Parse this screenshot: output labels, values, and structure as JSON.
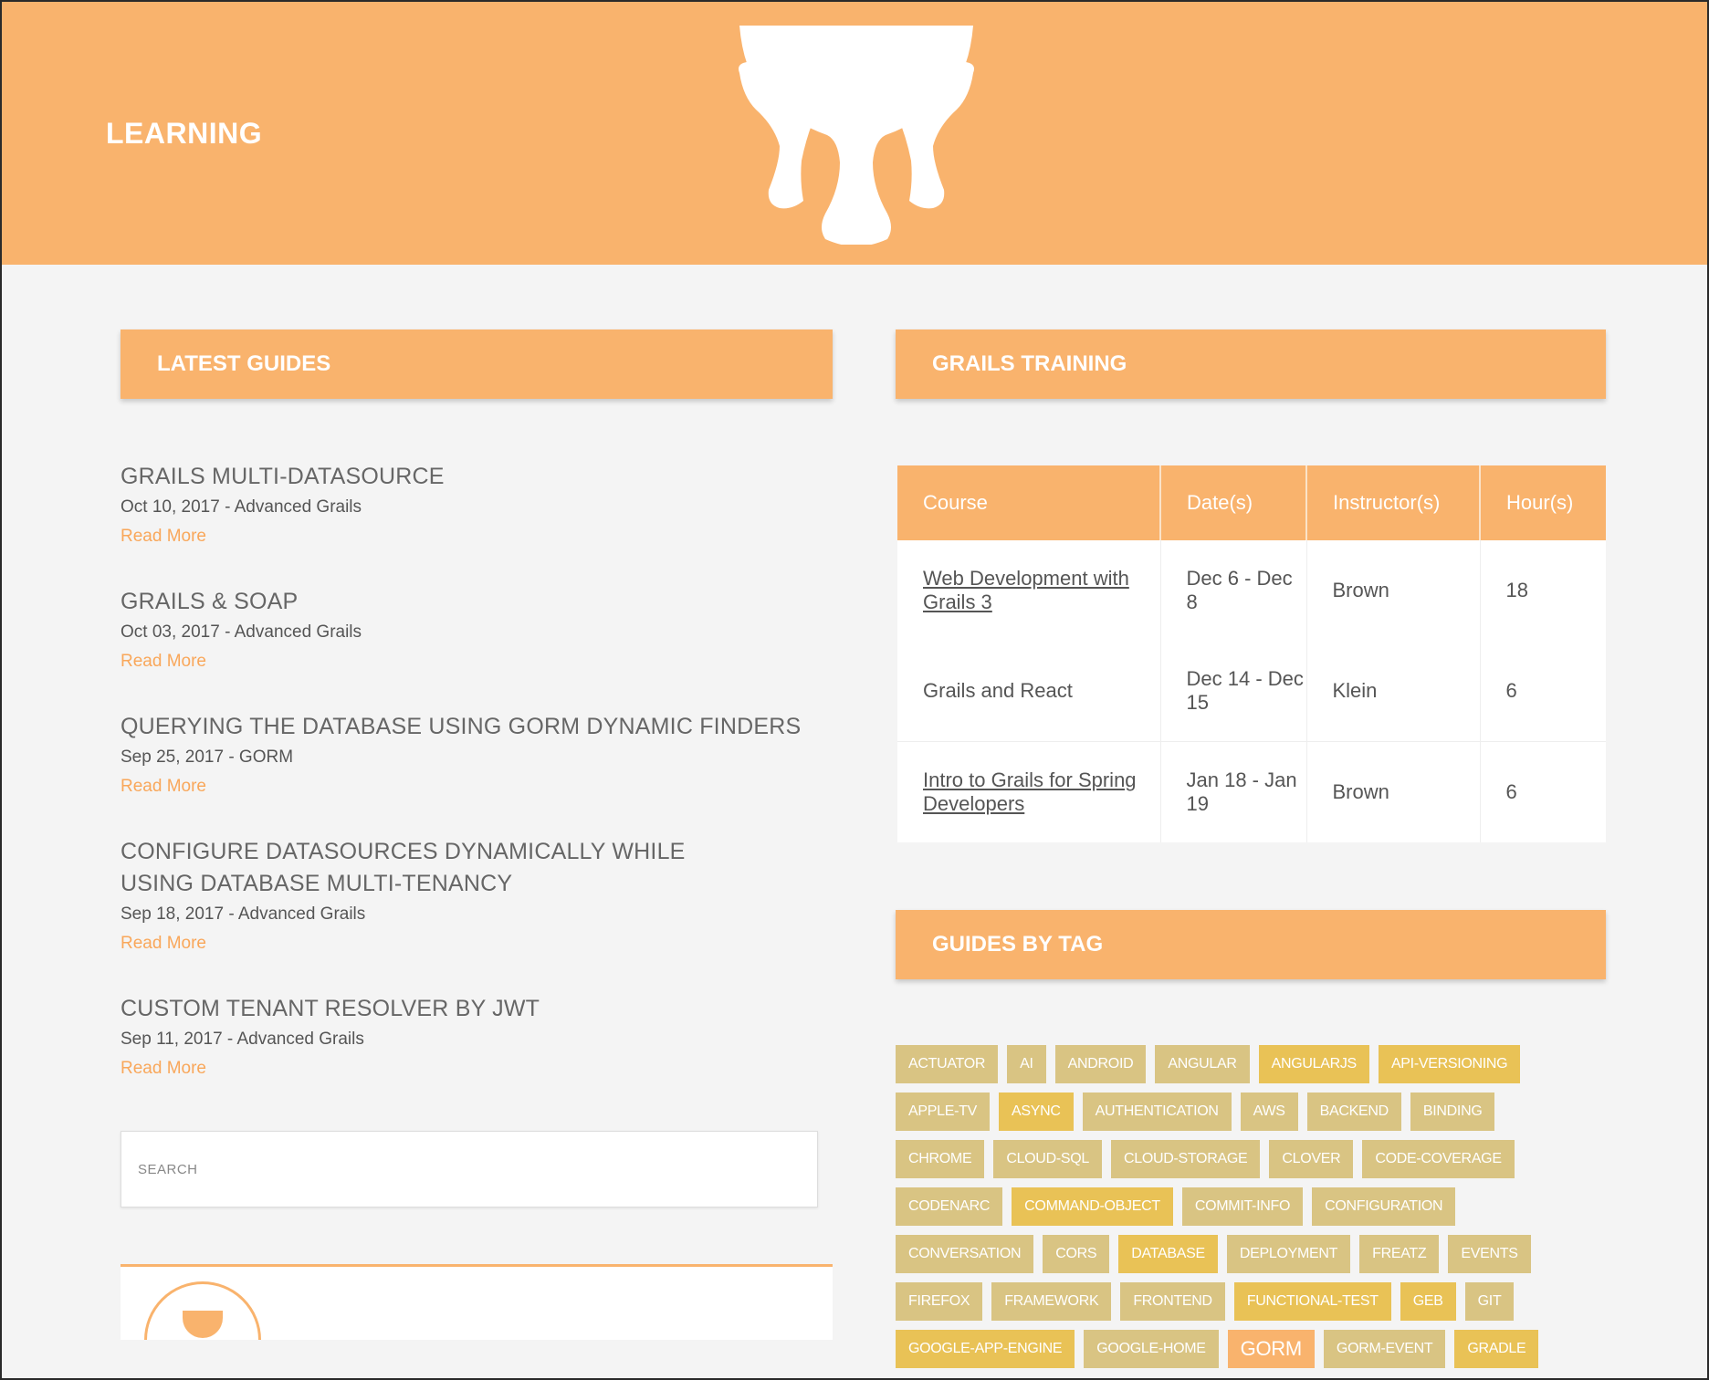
{
  "header": {
    "title": "LEARNING"
  },
  "latest_guides": {
    "heading": "LATEST GUIDES",
    "items": [
      {
        "title": "GRAILS MULTI-DATASOURCE",
        "meta": "Oct 10, 2017 - Advanced Grails",
        "more": "Read More"
      },
      {
        "title": "GRAILS & SOAP",
        "meta": "Oct 03, 2017 - Advanced Grails",
        "more": "Read More"
      },
      {
        "title": "QUERYING THE DATABASE USING GORM DYNAMIC FINDERS",
        "meta": "Sep 25, 2017 - GORM",
        "more": "Read More"
      },
      {
        "title": "CONFIGURE DATASOURCES DYNAMICALLY WHILE USING DATABASE MULTI-TENANCY",
        "meta": "Sep 18, 2017 - Advanced Grails",
        "more": "Read More"
      },
      {
        "title": "CUSTOM TENANT RESOLVER BY JWT",
        "meta": "Sep 11, 2017 - Advanced Grails",
        "more": "Read More"
      }
    ]
  },
  "search": {
    "placeholder": "SEARCH"
  },
  "training": {
    "heading": "GRAILS TRAINING",
    "columns": [
      "Course",
      "Date(s)",
      "Instructor(s)",
      "Hour(s)"
    ],
    "rows": [
      {
        "course": "Web Development with Grails 3",
        "dates": "Dec 6 - Dec 8",
        "instructor": "Brown",
        "hours": "18"
      },
      {
        "course": "Grails and React",
        "dates": "Dec 14 - Dec 15",
        "instructor": "Klein",
        "hours": "6"
      },
      {
        "course": "Intro to Grails for Spring Developers",
        "dates": "Jan 18 - Jan 19",
        "instructor": "Brown",
        "hours": "6"
      }
    ]
  },
  "tags_section": {
    "heading": "GUIDES BY TAG",
    "tags": [
      "ACTUATOR",
      "AI",
      "ANDROID",
      "ANGULAR",
      "ANGULARJS",
      "API-VERSIONING",
      "APPLE-TV",
      "ASYNC",
      "AUTHENTICATION",
      "AWS",
      "BACKEND",
      "BINDING",
      "CHROME",
      "CLOUD-SQL",
      "CLOUD-STORAGE",
      "CLOVER",
      "CODE-COVERAGE",
      "CODENARC",
      "COMMAND-OBJECT",
      "COMMIT-INFO",
      "CONFIGURATION",
      "CONVERSATION",
      "CORS",
      "DATABASE",
      "DEPLOYMENT",
      "FREATZ",
      "EVENTS",
      "FIREFOX",
      "FRAMEWORK",
      "FRONTEND",
      "FUNCTIONAL-TEST",
      "GEB",
      "GIT",
      "GOOGLE-APP-ENGINE",
      "GOOGLE-HOME",
      "GORM",
      "GORM-EVENT",
      "GRADLE"
    ]
  },
  "colors": {
    "accent": "#f9b36d",
    "background": "#f4f4f4",
    "tag_muted": "#d9c483",
    "tag_bright": "#e9c256"
  }
}
